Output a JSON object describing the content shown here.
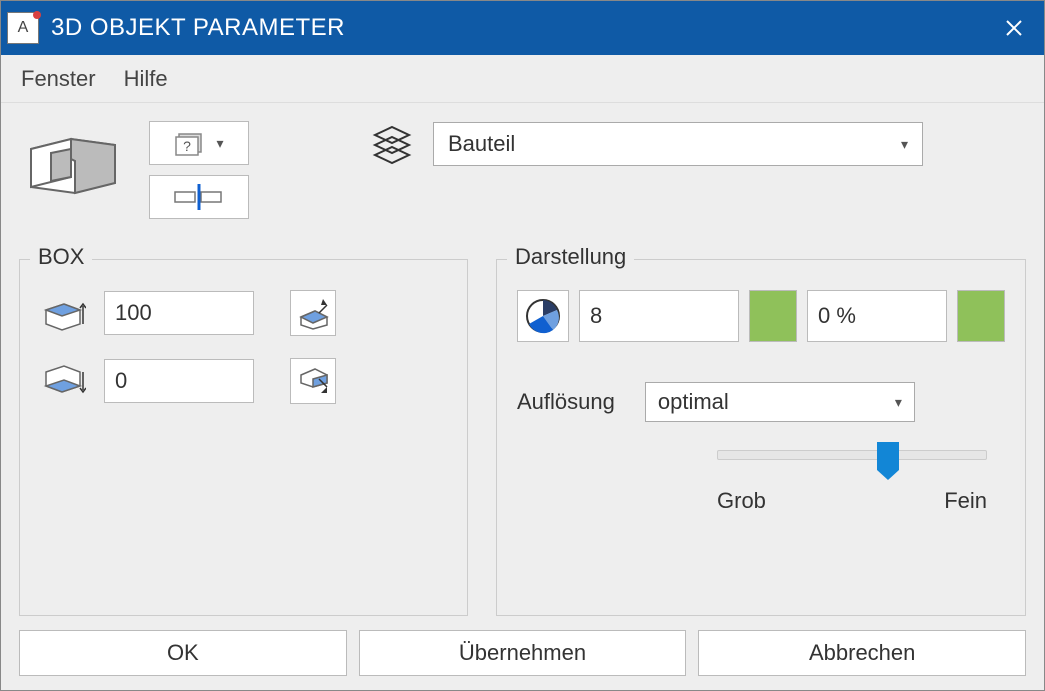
{
  "window": {
    "title": "3D OBJEKT PARAMETER",
    "app_letter": "A"
  },
  "menu": {
    "fenster": "Fenster",
    "hilfe": "Hilfe"
  },
  "top": {
    "layer_label": "Bauteil"
  },
  "box_panel": {
    "legend": "BOX",
    "height_value": "100",
    "base_value": "0"
  },
  "darstellung": {
    "legend": "Darstellung",
    "pen": "8",
    "opacity": "0 %",
    "aufl_label": "Auflösung",
    "aufl_value": "optimal",
    "slider_min": "Grob",
    "slider_max": "Fein"
  },
  "footer": {
    "ok": "OK",
    "apply": "Übernehmen",
    "cancel": "Abbrechen"
  }
}
